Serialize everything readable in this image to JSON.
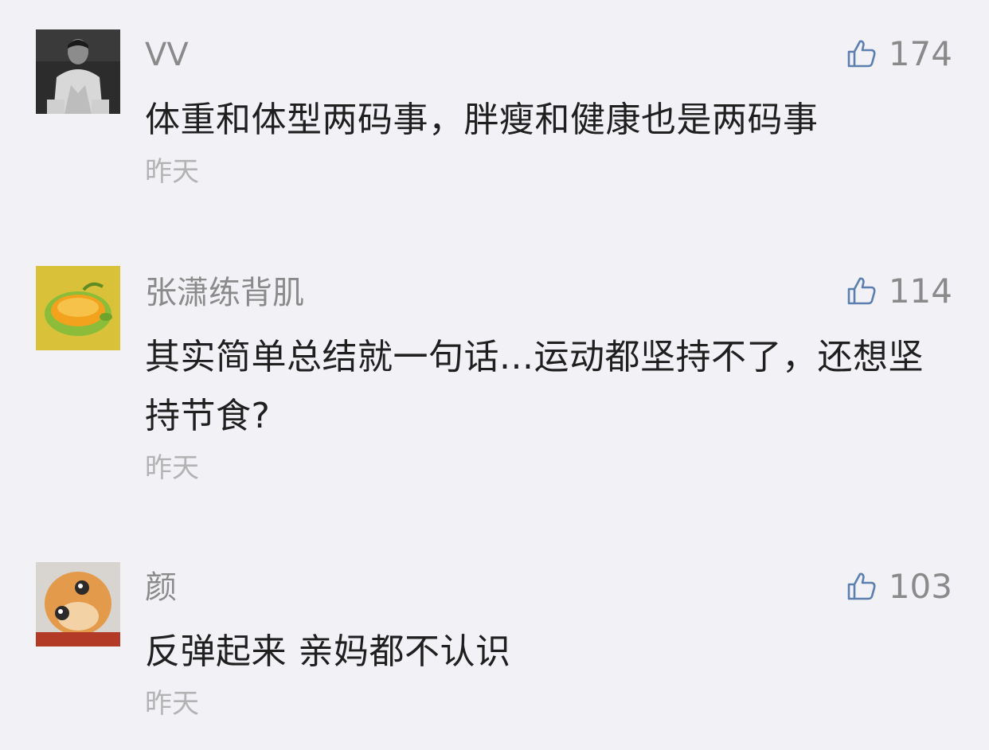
{
  "comments": [
    {
      "username": "VV",
      "likes": "174",
      "text": "体重和体型两码事，胖瘦和健康也是两码事",
      "time": "昨天"
    },
    {
      "username": "张潇练背肌",
      "likes": "114",
      "text": "其实简单总结就一句话...运动都坚持不了，还想坚持节食?",
      "time": "昨天"
    },
    {
      "username": "颜",
      "likes": "103",
      "text": "反弹起来 亲妈都不认识",
      "time": "昨天"
    }
  ],
  "icons": {
    "like": "thumbs-up-icon"
  },
  "colors": {
    "background": "#f2f1f6",
    "username": "#8a8a8a",
    "text": "#1f1f1f",
    "time": "#b3b3b3",
    "like_icon": "#5b7fae"
  }
}
